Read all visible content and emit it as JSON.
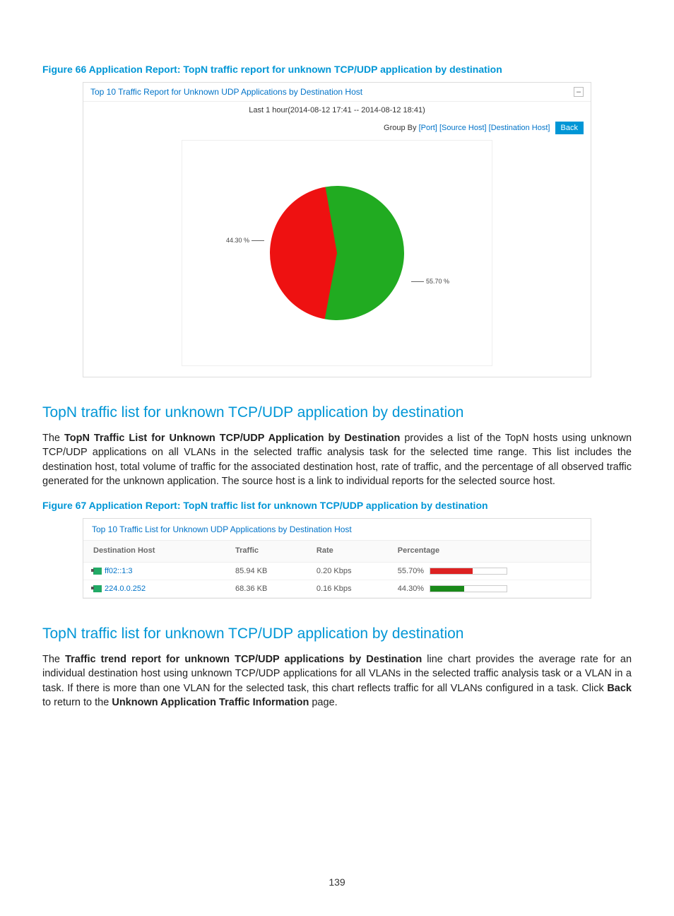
{
  "fig66": {
    "caption": "Figure 66 Application Report: TopN traffic report for unknown TCP/UDP application by destination",
    "panel_title": "Top 10 Traffic Report for Unknown UDP Applications by Destination Host",
    "time_range": "Last 1 hour(2014-08-12 17:41 -- 2014-08-12 18:41)",
    "group_by_prefix": "Group By ",
    "group_links": {
      "port": "[Port]",
      "src": "[Source Host]",
      "dst": "[Destination Host]"
    },
    "back_label": "Back"
  },
  "chart_data": {
    "type": "pie",
    "title": "",
    "slices": [
      {
        "label": "55.70 %",
        "value": 55.7,
        "color": "#21ab21"
      },
      {
        "label": "44.30 %",
        "value": 44.3,
        "color": "#ee1111"
      }
    ]
  },
  "section1": {
    "heading": "TopN traffic list for unknown TCP/UDP application by destination",
    "p_lead": "The ",
    "p_bold1": "TopN Traffic List for Unknown TCP/UDP Application by Destination",
    "p_rest": " provides a list of the TopN hosts using unknown TCP/UDP applications on all VLANs in the selected traffic analysis task for the selected time range. This list includes the destination host, total volume of traffic for the associated destination host, rate of traffic, and the percentage of all observed traffic generated for the unknown application. The source host is a link to individual reports for the selected source host."
  },
  "fig67": {
    "caption": "Figure 67 Application Report: TopN traffic list for unknown TCP/UDP application by destination",
    "panel_title": "Top 10 Traffic List for Unknown UDP Applications by Destination Host",
    "headers": {
      "dst": "Destination Host",
      "traffic": "Traffic",
      "rate": "Rate",
      "pct": "Percentage"
    },
    "rows": [
      {
        "host": "ff02::1:3",
        "traffic": "85.94 KB",
        "rate": "0.20 Kbps",
        "pct_text": "55.70%",
        "pct_val": 55.7,
        "bar_color": "red"
      },
      {
        "host": "224.0.0.252",
        "traffic": "68.36 KB",
        "rate": "0.16 Kbps",
        "pct_text": "44.30%",
        "pct_val": 44.3,
        "bar_color": "green"
      }
    ]
  },
  "section2": {
    "heading": "TopN traffic list for unknown TCP/UDP application by destination",
    "p_lead": "The ",
    "p_bold1": "Traffic trend report for unknown TCP/UDP applications by Destination",
    "p_mid1": " line chart provides the average rate for an individual destination host using unknown TCP/UDP applications for all VLANs in the selected traffic analysis task or a VLAN in a task. If there is more than one VLAN for the selected task, this chart reflects traffic for all VLANs configured in a task. Click ",
    "p_bold2": "Back",
    "p_mid2": " to return to the ",
    "p_bold3": "Unknown Application Traffic Information",
    "p_end": " page."
  },
  "page_number": "139"
}
